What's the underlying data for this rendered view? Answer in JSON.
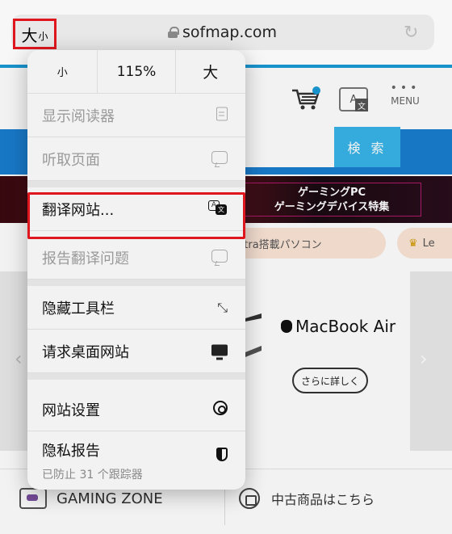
{
  "address_bar": {
    "aa_large": "大",
    "aa_small": "小",
    "url": "sofmap.com"
  },
  "site": {
    "menu_label": "MENU",
    "search_button": "検 索",
    "banner_line1": "ゲーミングPC",
    "banner_line2": "ゲーミングデバイス特集",
    "chips": [
      "ore Ultra搭載パソコン",
      "Le"
    ],
    "slide_title": "MacBook Air",
    "slide_button": "さらに詳しく",
    "bottom_left": "GAMING ZONE",
    "bottom_right": "中古商品はこちら"
  },
  "popover": {
    "zoom": {
      "smaller": "小",
      "percent": "115%",
      "larger": "大"
    },
    "items": [
      {
        "label": "显示阅读器",
        "icon": "reader-icon",
        "disabled": true
      },
      {
        "label": "听取页面",
        "icon": "speaker-bubble-icon",
        "disabled": true
      },
      {
        "label": "翻译网站...",
        "icon": "translate-icon",
        "disabled": false
      },
      {
        "label": "报告翻译问题",
        "icon": "report-bubble-icon",
        "disabled": true
      },
      {
        "label": "隐藏工具栏",
        "icon": "expand-arrows-icon",
        "disabled": false
      },
      {
        "label": "请求桌面网站",
        "icon": "monitor-icon",
        "disabled": false
      },
      {
        "label": "网站设置",
        "icon": "gear-icon",
        "disabled": false
      },
      {
        "label": "隐私报告",
        "icon": "shield-icon",
        "disabled": false
      }
    ],
    "privacy_sub": "已防止 31 个跟踪器"
  },
  "colors": {
    "highlight": "#e0161e",
    "site_blue": "#1a7ed0",
    "search_blue": "#37b5e8"
  }
}
